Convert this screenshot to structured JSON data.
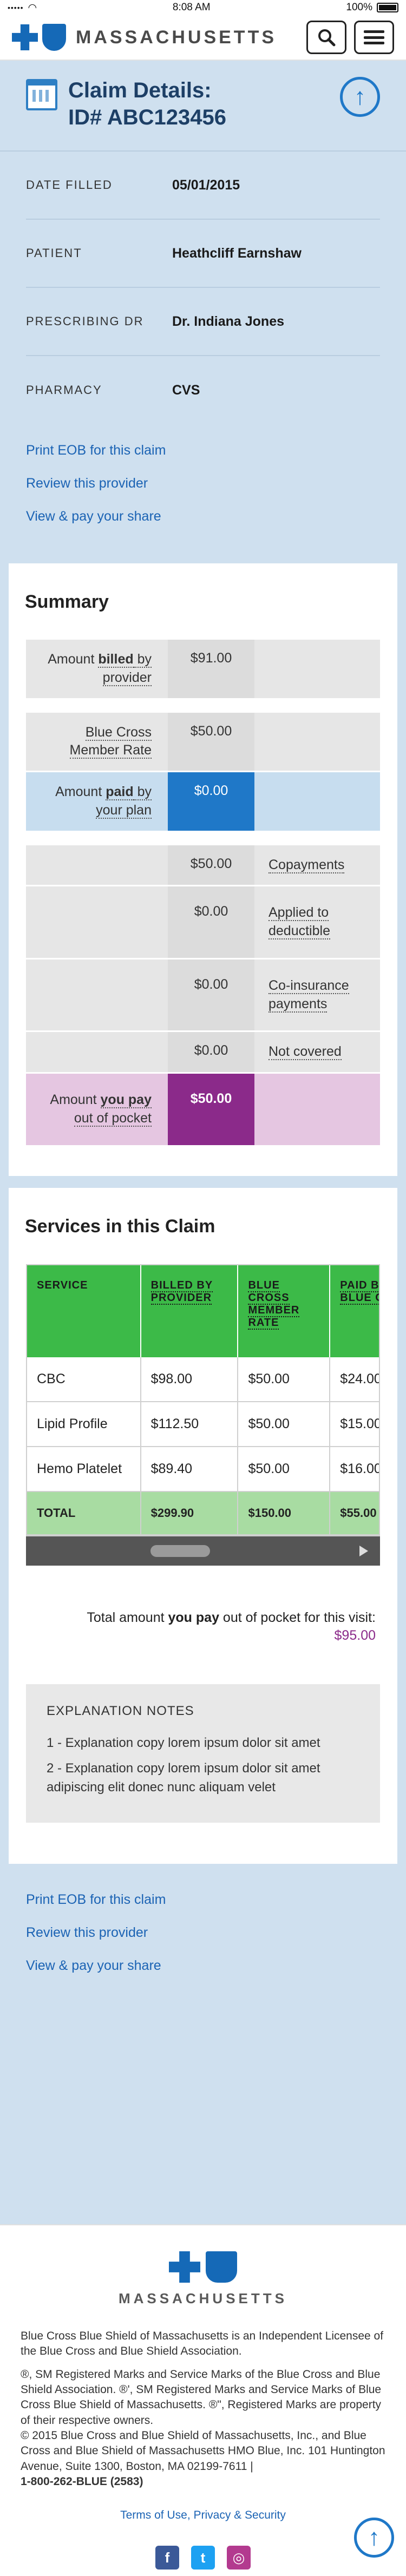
{
  "status_bar": {
    "carrier_dots": "•••••",
    "time": "8:08 AM",
    "battery": "100%"
  },
  "header": {
    "brand": "MASSACHUSETTS"
  },
  "claim": {
    "title_line1": "Claim Details:",
    "title_line2": "ID# ABC123456",
    "rows": [
      {
        "label": "DATE FILLED",
        "value": "05/01/2015"
      },
      {
        "label": "PATIENT",
        "value": "Heathcliff Earnshaw"
      },
      {
        "label": "PRESCRIBING DR",
        "value": "Dr. Indiana Jones"
      },
      {
        "label": "PHARMACY",
        "value": "CVS"
      }
    ],
    "links": [
      "Print EOB for this claim",
      "Review this provider",
      "View & pay your share"
    ]
  },
  "summary": {
    "title": "Summary",
    "billed": {
      "pre": "Amount ",
      "bold": "billed",
      "post": " by provider",
      "value": "$91.00"
    },
    "member_rate": {
      "label": "Blue Cross Member Rate",
      "value": "$50.00"
    },
    "paid": {
      "pre": "Amount ",
      "bold": "paid",
      "post": " by your plan",
      "value": "$0.00"
    },
    "breakdown": [
      {
        "value": "$50.00",
        "label": "Copayments"
      },
      {
        "value": "$0.00",
        "label": "Applied to deductible"
      },
      {
        "value": "$0.00",
        "label": "Co-insurance payments"
      },
      {
        "value": "$0.00",
        "label": "Not covered"
      }
    ],
    "you_pay": {
      "pre": "Amount ",
      "bold": "you pay",
      "post": " out of pocket",
      "value": "$50.00"
    }
  },
  "services": {
    "title": "Services in this Claim",
    "headers": [
      "SERVICE",
      "BILLED BY PROVIDER",
      "BLUE CROSS MEMBER RATE",
      "PAID BY BLUE CROSS"
    ],
    "rows": [
      {
        "service": "CBC",
        "billed": "$98.00",
        "rate": "$50.00",
        "paid": "$24.00"
      },
      {
        "service": "Lipid Profile",
        "billed": "$112.50",
        "rate": "$50.00",
        "paid": "$15.00"
      },
      {
        "service": "Hemo Platelet",
        "billed": "$89.40",
        "rate": "$50.00",
        "paid": "$16.00"
      }
    ],
    "total": {
      "label": "TOTAL",
      "billed": "$299.90",
      "rate": "$150.00",
      "paid": "$55.00"
    },
    "visit_total_pre": "Total amount ",
    "visit_total_bold": "you pay",
    "visit_total_post": " out of pocket for this visit:",
    "visit_total_amount": "$95.00",
    "notes_title": "EXPLANATION NOTES",
    "notes": [
      "1 - Explanation copy lorem ipsum dolor sit amet",
      "2 - Explanation copy lorem ipsum dolor sit amet adipiscing elit donec nunc aliquam velet"
    ]
  },
  "bottom_links": [
    "Print EOB for this claim",
    "Review this provider",
    "View & pay your share"
  ],
  "footer": {
    "brand": "MASSACHUSETTS",
    "para1": "Blue Cross Blue Shield of Massachusetts is an Independent Licensee of the Blue Cross and Blue Shield Association.",
    "para2": "®, SM Registered Marks and Service Marks of the Blue Cross and Blue Shield Association. ®', SM Registered Marks and Service Marks of Blue Cross Blue Shield of Massachusetts. ®\", Registered Marks are property of their respective owners.",
    "para3": "© 2015 Blue Cross and Blue Shield of Massachusetts, Inc., and Blue Cross and Blue Shield of Massachusetts HMO Blue, Inc. 101 Huntington Avenue, Suite 1300, Boston, MA 02199-7611 |",
    "phone": "1-800-262-BLUE (2583)",
    "terms": "Terms of Use, Privacy & Security",
    "social": {
      "facebook": "f",
      "twitter": "t",
      "instagram": "◎"
    }
  },
  "colors": {
    "accent_blue": "#1f78c8",
    "pay_purple": "#8b2a8a",
    "table_green": "#3cba48",
    "page_bg": "#cfe0ef"
  }
}
